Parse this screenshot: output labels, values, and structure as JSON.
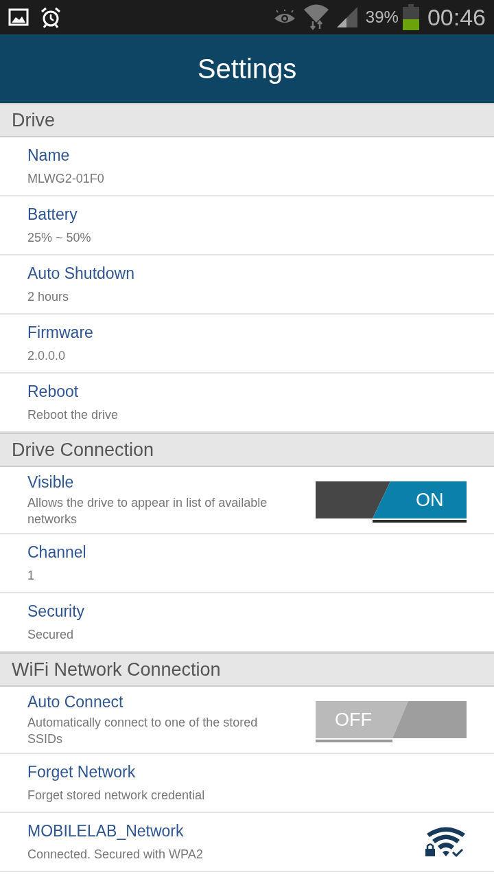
{
  "status_bar": {
    "battery_percent": "39%",
    "time": "00:46"
  },
  "title": "Settings",
  "sections": [
    {
      "title": "Drive",
      "rows": [
        {
          "kind": "text",
          "title": "Name",
          "subtitle": "MLWG2-01F0"
        },
        {
          "kind": "text",
          "title": "Battery",
          "subtitle": "25% ~ 50%"
        },
        {
          "kind": "text",
          "title": "Auto Shutdown",
          "subtitle": "2 hours"
        },
        {
          "kind": "text",
          "title": "Firmware",
          "subtitle": "2.0.0.0"
        },
        {
          "kind": "text",
          "title": "Reboot",
          "subtitle": "Reboot the drive"
        }
      ]
    },
    {
      "title": "Drive Connection",
      "rows": [
        {
          "kind": "toggle",
          "title": "Visible",
          "subtitle": "Allows the drive to appear in list of available networks",
          "on": true,
          "toggle_label": "ON"
        },
        {
          "kind": "text",
          "title": "Channel",
          "subtitle": "1"
        },
        {
          "kind": "text",
          "title": "Security",
          "subtitle": "Secured"
        }
      ]
    },
    {
      "title": "WiFi Network Connection",
      "rows": [
        {
          "kind": "toggle",
          "title": "Auto Connect",
          "subtitle": "Automatically connect to one of the stored SSIDs",
          "on": false,
          "toggle_label": "OFF"
        },
        {
          "kind": "text",
          "title": "Forget Network",
          "subtitle": "Forget stored network credential"
        },
        {
          "kind": "network",
          "title": "MOBILELAB_Network",
          "subtitle": "Connected. Secured with WPA2"
        }
      ]
    }
  ]
}
